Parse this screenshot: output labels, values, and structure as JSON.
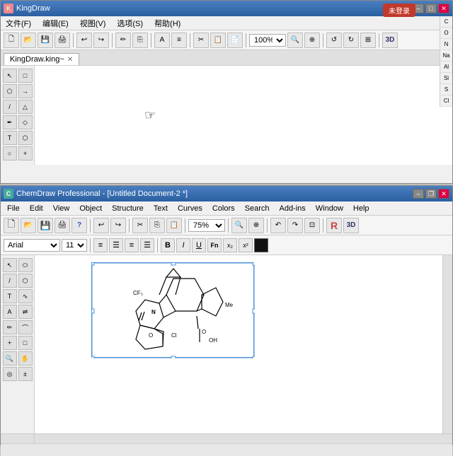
{
  "king": {
    "title": "KingDraw",
    "tab": "KingDraw.king~",
    "reg_btn": "未登录",
    "menu": [
      "文件(F)",
      "编辑(E)",
      "视图(V)",
      "选项(S)",
      "帮助(H)"
    ],
    "zoom": "100%",
    "right_labels": [
      "C",
      "O",
      "N",
      "Na",
      "Al",
      "Si",
      "S",
      "Cl"
    ]
  },
  "chem": {
    "title": "ChemDraw Professional - [Untitled Document-2 *]",
    "menu": [
      "File",
      "Edit",
      "View",
      "Object",
      "Structure",
      "Text",
      "Curves",
      "Colors",
      "Search",
      "Add-ins",
      "Window",
      "Help"
    ],
    "zoom": "75%",
    "font": "Arial",
    "size": "11",
    "toolbar_btns": [
      "new",
      "open",
      "save",
      "print",
      "help",
      "undo",
      "redo",
      "cut",
      "copy",
      "paste",
      "zoom-in",
      "zoom-out",
      "fit",
      "3d"
    ],
    "format_btns": [
      "B",
      "I",
      "U",
      "sub-label",
      "sub",
      "sup",
      "color-box"
    ],
    "align_btns": [
      "align-left",
      "align-center",
      "align-right",
      "align-justify"
    ],
    "statusbar": ""
  },
  "icons": {
    "minimize": "–",
    "maximize": "□",
    "close": "✕",
    "restore": "❐",
    "arrow_down": "▼",
    "arrow_right": "▶"
  }
}
